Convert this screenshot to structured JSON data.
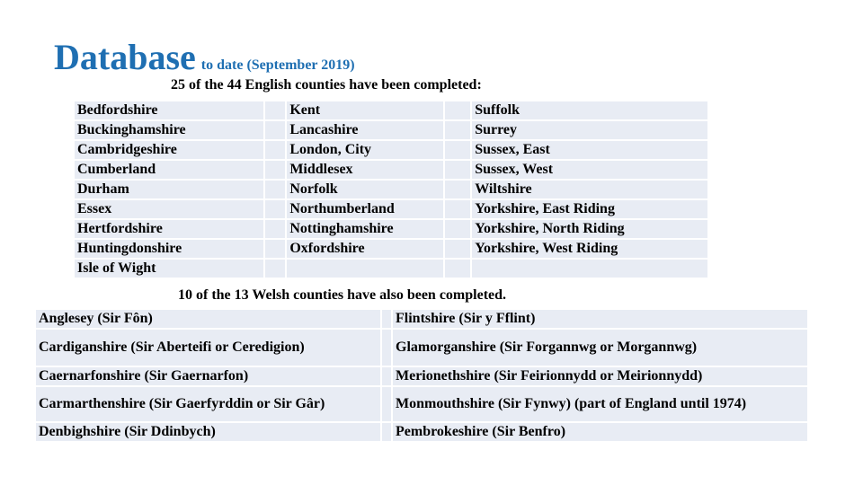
{
  "title": {
    "main": "Database",
    "sub": "to date (September 2019)"
  },
  "english": {
    "heading": "25 of the 44 English counties have been completed:",
    "columns": [
      [
        "Bedfordshire",
        "Buckinghamshire",
        "Cambridgeshire",
        "Cumberland",
        "Durham",
        "Essex",
        "Hertfordshire",
        "Huntingdonshire",
        "Isle of Wight"
      ],
      [
        "Kent",
        "Lancashire",
        "London, City",
        "Middlesex",
        "Norfolk",
        "Northumberland",
        "Nottinghamshire",
        "Oxfordshire",
        ""
      ],
      [
        "Suffolk",
        "Surrey",
        "Sussex, East",
        "Sussex, West",
        "Wiltshire",
        "Yorkshire, East Riding",
        "Yorkshire, North Riding",
        "Yorkshire, West Riding",
        ""
      ]
    ]
  },
  "welsh": {
    "heading": "10 of the 13 Welsh counties have also been completed.",
    "columns": [
      [
        "Anglesey (Sir Fôn)",
        "Cardiganshire (Sir Aberteifi or Ceredigion)",
        "Caernarfonshire (Sir Gaernarfon)",
        "Carmarthenshire (Sir Gaerfyrddin or Sir Gâr)",
        "Denbighshire (Sir Ddinbych)"
      ],
      [
        "Flintshire (Sir y Fflint)",
        "Glamorganshire (Sir Forgannwg or Morgannwg)",
        "Merionethshire (Sir Feirionnydd or Meirionnydd)",
        "Monmouthshire (Sir Fynwy) (part of England until 1974)",
        "Pembrokeshire (Sir Benfro)"
      ]
    ]
  },
  "colors": {
    "title": "#1f6fb2",
    "cell_background": "#e8ecf4"
  }
}
